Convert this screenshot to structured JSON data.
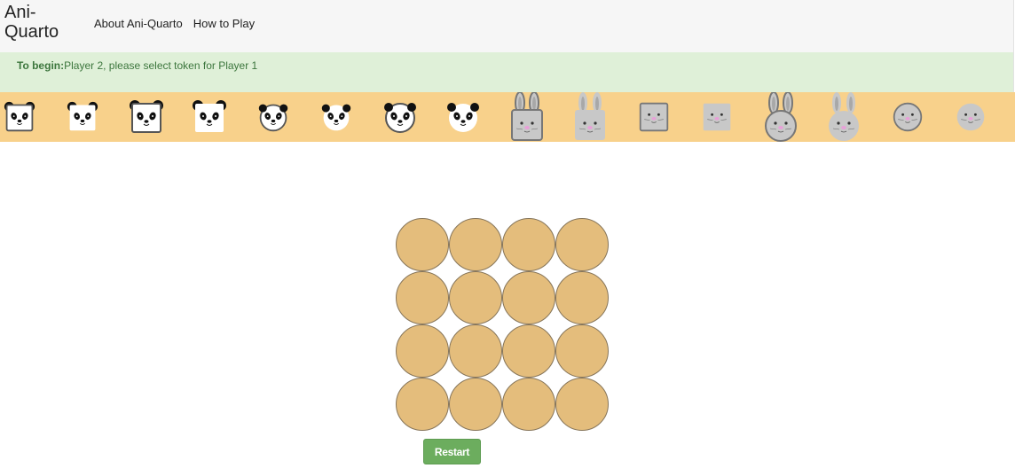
{
  "header": {
    "brand": "Ani-Quarto",
    "nav": [
      {
        "label": "About Ani-Quarto"
      },
      {
        "label": "How to Play"
      }
    ]
  },
  "status": {
    "prefix": "To begin:",
    "message": "Player 2, please select token for Player 1"
  },
  "tokens": [
    {
      "animal": "panda",
      "shape": "square",
      "size": "small",
      "outlined": true
    },
    {
      "animal": "panda",
      "shape": "square",
      "size": "small",
      "outlined": false
    },
    {
      "animal": "panda",
      "shape": "square",
      "size": "large",
      "outlined": true
    },
    {
      "animal": "panda",
      "shape": "square",
      "size": "large",
      "outlined": false
    },
    {
      "animal": "panda",
      "shape": "round",
      "size": "small",
      "outlined": true
    },
    {
      "animal": "panda",
      "shape": "round",
      "size": "small",
      "outlined": false
    },
    {
      "animal": "panda",
      "shape": "round",
      "size": "large",
      "outlined": true
    },
    {
      "animal": "panda",
      "shape": "round",
      "size": "large",
      "outlined": false
    },
    {
      "animal": "bunny",
      "shape": "square",
      "size": "large",
      "outlined": true
    },
    {
      "animal": "bunny",
      "shape": "square",
      "size": "large",
      "outlined": false
    },
    {
      "animal": "mouse",
      "shape": "square",
      "size": "small",
      "outlined": true
    },
    {
      "animal": "mouse",
      "shape": "square",
      "size": "small",
      "outlined": false
    },
    {
      "animal": "bunny",
      "shape": "round",
      "size": "large",
      "outlined": true
    },
    {
      "animal": "bunny",
      "shape": "round",
      "size": "large",
      "outlined": false
    },
    {
      "animal": "mouse",
      "shape": "round",
      "size": "small",
      "outlined": true
    },
    {
      "animal": "mouse",
      "shape": "round",
      "size": "small",
      "outlined": false
    }
  ],
  "board": {
    "rows": 4,
    "cols": 4
  },
  "restart_label": "Restart",
  "colors": {
    "header_bg": "#f6f6f6",
    "alert_bg": "#dff0d8",
    "alert_text": "#3c763d",
    "token_bar_bg": "#f8d18b",
    "cell_fill": "#e4bd7c",
    "cell_border": "#86755a",
    "restart_bg": "#6cad5e"
  }
}
